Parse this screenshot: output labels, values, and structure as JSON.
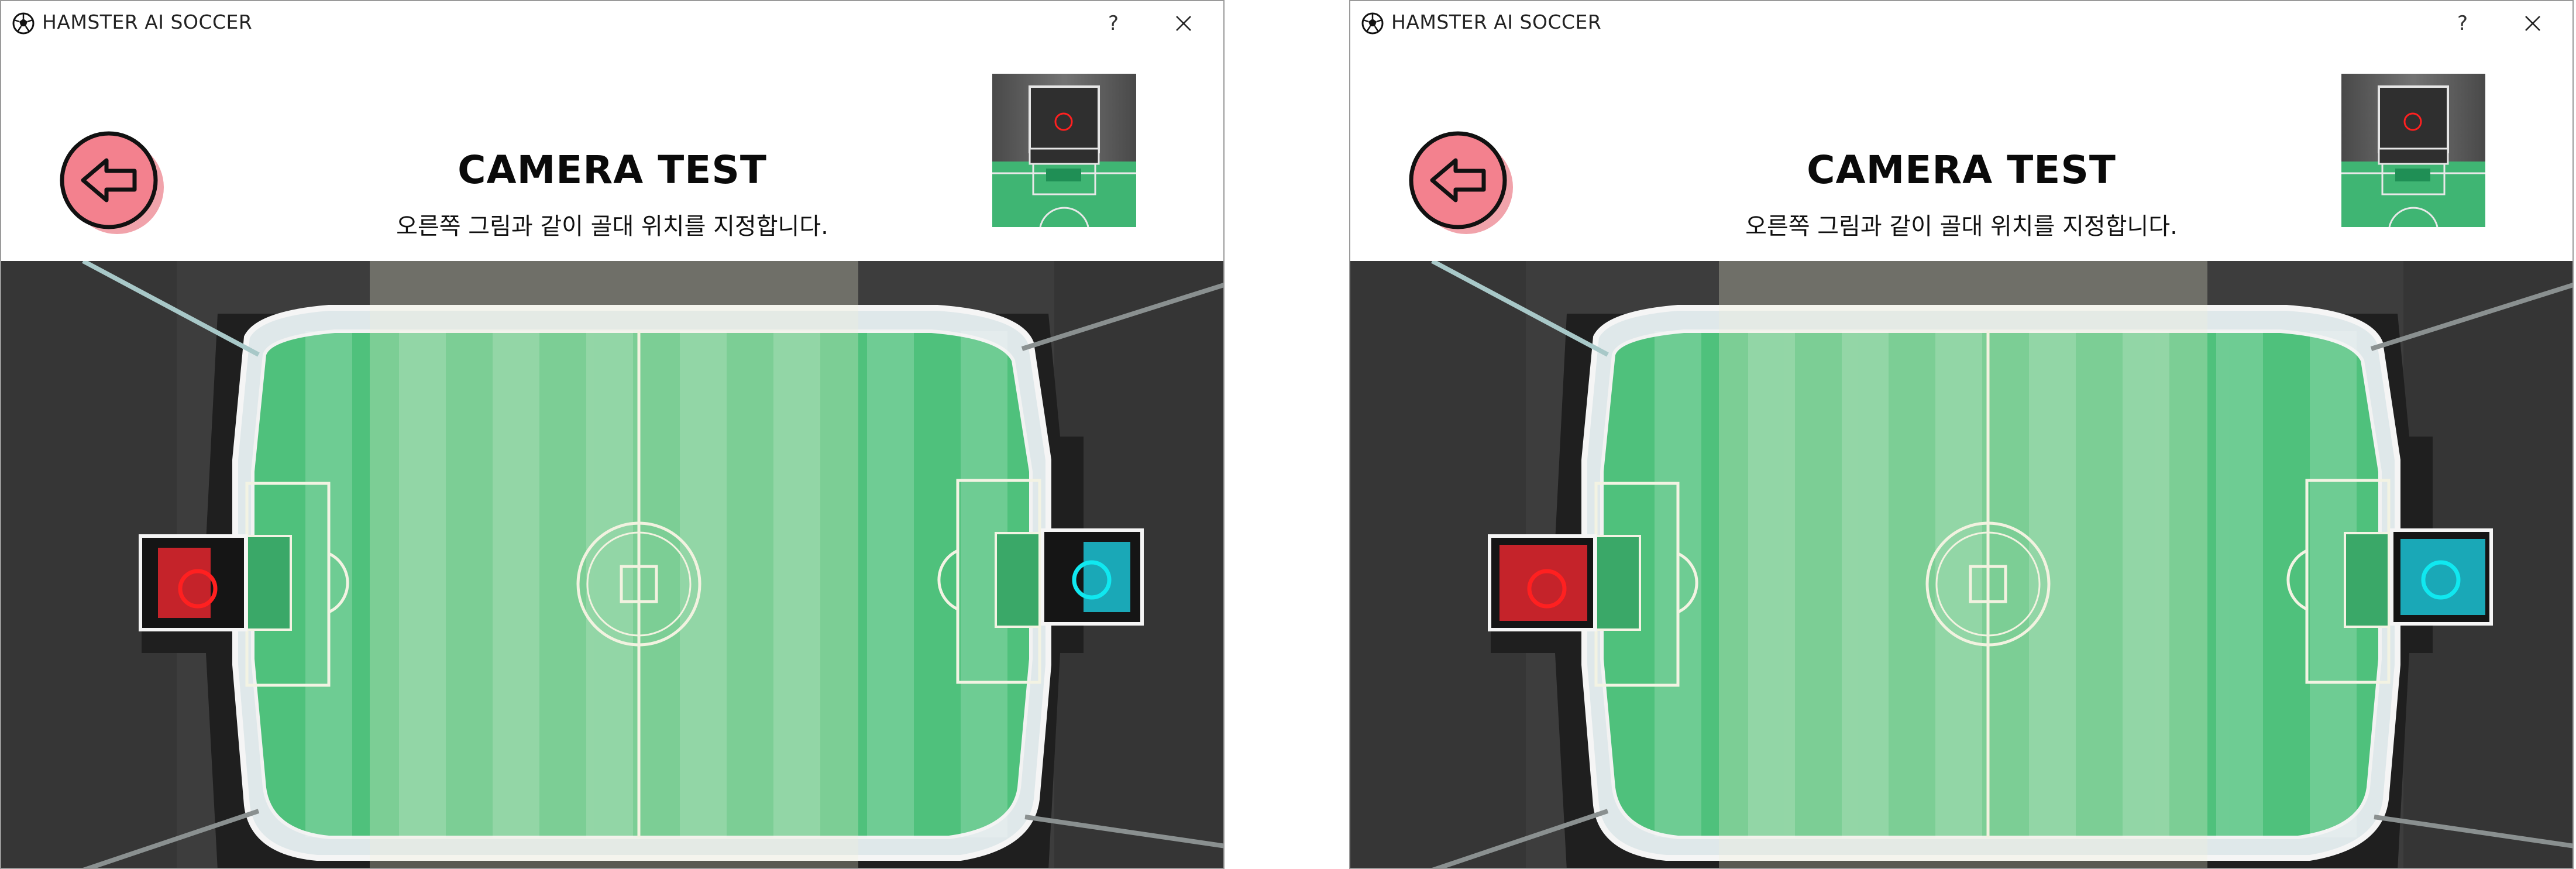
{
  "windows": [
    {
      "app_title": "HAMSTER AI SOCCER",
      "help_label": "?",
      "page_title": "CAMERA TEST",
      "page_subtitle": "오른쪽 그림과 같이 골대 위치를 지정합니다.",
      "icons": {
        "app": "soccer-ball-icon",
        "back": "back-arrow-icon",
        "close": "close-icon"
      },
      "goal_markers": {
        "left": "red",
        "right": "cyan"
      },
      "colors": {
        "back_button_fill": "#f3818e",
        "back_button_shadow": "#f1a3ab",
        "pitch_green": "#4fc17c",
        "left_marker": "#ff2020",
        "right_marker": "#10e8f0"
      }
    },
    {
      "app_title": "HAMSTER AI SOCCER",
      "help_label": "?",
      "page_title": "CAMERA TEST",
      "page_subtitle": "오른쪽 그림과 같이 골대 위치를 지정합니다.",
      "icons": {
        "app": "soccer-ball-icon",
        "back": "back-arrow-icon",
        "close": "close-icon"
      },
      "goal_markers": {
        "left": "red",
        "right": "cyan"
      },
      "colors": {
        "back_button_fill": "#f3818e",
        "back_button_shadow": "#f1a3ab",
        "pitch_green": "#4fc17c",
        "left_marker": "#ff2020",
        "right_marker": "#10e8f0"
      }
    }
  ]
}
